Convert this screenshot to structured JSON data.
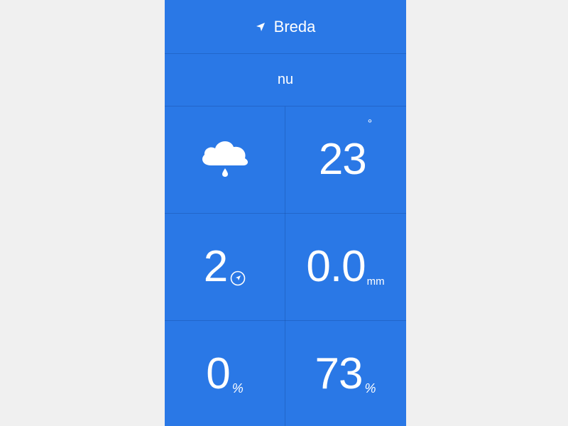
{
  "location": {
    "city": "Breda",
    "icon": "location-arrow-icon"
  },
  "time_label": "nu",
  "weather": {
    "condition_icon": "rain-cloud-icon",
    "temperature": "23",
    "temperature_unit": "°",
    "wind_speed": "2",
    "wind_icon": "compass-icon",
    "precipitation": "0.0",
    "precipitation_unit": "mm",
    "rain_chance": "0",
    "rain_chance_unit": "%",
    "humidity": "73",
    "humidity_unit": "%"
  },
  "colors": {
    "background": "#2a78e6",
    "text": "#ffffff",
    "page": "#f0f0f0"
  }
}
